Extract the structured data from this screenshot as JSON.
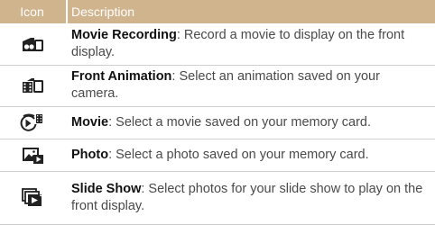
{
  "table": {
    "header": {
      "icon": "Icon",
      "description": "Description"
    },
    "rows": [
      {
        "icon": "movie-recording-icon",
        "title": "Movie Recording",
        "desc": ": Record a movie to display on the front display."
      },
      {
        "icon": "front-animation-icon",
        "title": "Front Animation",
        "desc": ": Select an animation saved on your camera."
      },
      {
        "icon": "movie-icon",
        "title": "Movie",
        "desc": ": Select a movie saved on your memory card."
      },
      {
        "icon": "photo-icon",
        "title": "Photo",
        "desc": ": Select a photo saved on your memory card."
      },
      {
        "icon": "slide-show-icon",
        "title": "Slide Show",
        "desc": ": Select photos for your slide show to play on the front display."
      }
    ]
  },
  "colors": {
    "header_bg": "#d0b48e",
    "header_text": "#ffffff",
    "divider": "#cfcfcf"
  }
}
